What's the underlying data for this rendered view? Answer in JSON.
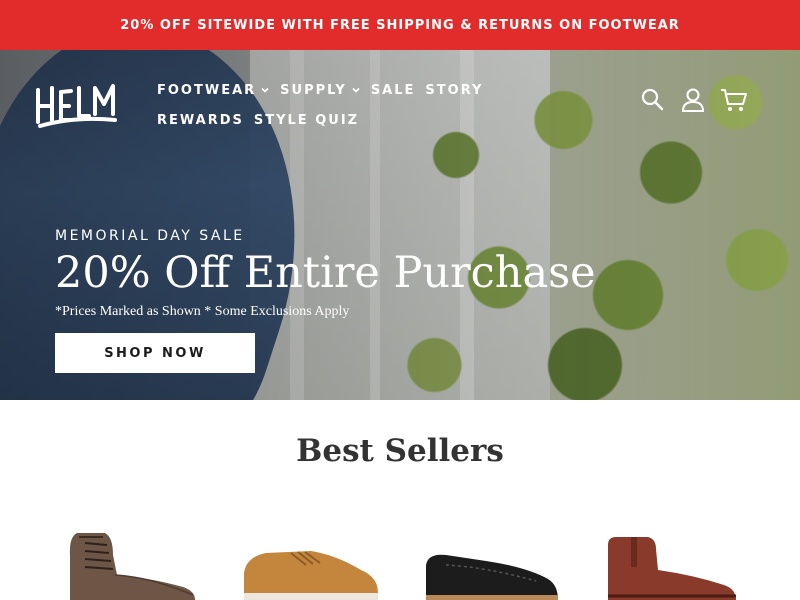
{
  "promo": {
    "text": "20% OFF SITEWIDE WITH FREE SHIPPING & RETURNS ON FOOTWEAR"
  },
  "brand": {
    "logo_text": "HELM",
    "promo_color": "#e22c2c"
  },
  "nav": {
    "items": [
      {
        "label": "FOOTWEAR",
        "has_dropdown": true
      },
      {
        "label": "SUPPLY",
        "has_dropdown": true
      },
      {
        "label": "SALE",
        "has_dropdown": false
      },
      {
        "label": "STORY",
        "has_dropdown": false
      },
      {
        "label": "REWARDS",
        "has_dropdown": false
      },
      {
        "label": "STYLE QUIZ",
        "has_dropdown": false
      }
    ]
  },
  "header_icons": [
    "search-icon",
    "account-icon",
    "cart-icon"
  ],
  "hero": {
    "eyebrow": "MEMORIAL DAY SALE",
    "headline": "20% Off Entire Purchase",
    "fineprint": "*Prices Marked as Shown * Some Exclusions Apply",
    "cta": "SHOP NOW"
  },
  "best_sellers": {
    "title": "Best Sellers",
    "products": [
      {
        "name": "brown-lace-up-boot",
        "color": "#6e5646"
      },
      {
        "name": "tan-sneaker",
        "color": "#c4863c"
      },
      {
        "name": "black-loafer",
        "color": "#1c1c1c"
      },
      {
        "name": "brown-chelsea-boot",
        "color": "#8a3a2a"
      }
    ]
  }
}
